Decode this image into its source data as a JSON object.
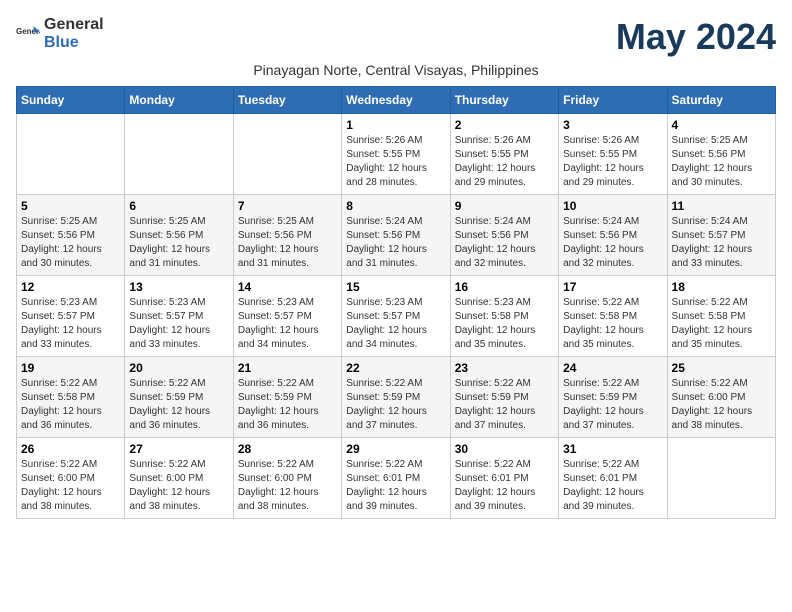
{
  "logo": {
    "general": "General",
    "blue": "Blue"
  },
  "title": "May 2024",
  "subtitle": "Pinayagan Norte, Central Visayas, Philippines",
  "days_header": [
    "Sunday",
    "Monday",
    "Tuesday",
    "Wednesday",
    "Thursday",
    "Friday",
    "Saturday"
  ],
  "weeks": [
    [
      {
        "day": "",
        "info": ""
      },
      {
        "day": "",
        "info": ""
      },
      {
        "day": "",
        "info": ""
      },
      {
        "day": "1",
        "info": "Sunrise: 5:26 AM\nSunset: 5:55 PM\nDaylight: 12 hours and 28 minutes."
      },
      {
        "day": "2",
        "info": "Sunrise: 5:26 AM\nSunset: 5:55 PM\nDaylight: 12 hours and 29 minutes."
      },
      {
        "day": "3",
        "info": "Sunrise: 5:26 AM\nSunset: 5:55 PM\nDaylight: 12 hours and 29 minutes."
      },
      {
        "day": "4",
        "info": "Sunrise: 5:25 AM\nSunset: 5:56 PM\nDaylight: 12 hours and 30 minutes."
      }
    ],
    [
      {
        "day": "5",
        "info": "Sunrise: 5:25 AM\nSunset: 5:56 PM\nDaylight: 12 hours and 30 minutes."
      },
      {
        "day": "6",
        "info": "Sunrise: 5:25 AM\nSunset: 5:56 PM\nDaylight: 12 hours and 31 minutes."
      },
      {
        "day": "7",
        "info": "Sunrise: 5:25 AM\nSunset: 5:56 PM\nDaylight: 12 hours and 31 minutes."
      },
      {
        "day": "8",
        "info": "Sunrise: 5:24 AM\nSunset: 5:56 PM\nDaylight: 12 hours and 31 minutes."
      },
      {
        "day": "9",
        "info": "Sunrise: 5:24 AM\nSunset: 5:56 PM\nDaylight: 12 hours and 32 minutes."
      },
      {
        "day": "10",
        "info": "Sunrise: 5:24 AM\nSunset: 5:56 PM\nDaylight: 12 hours and 32 minutes."
      },
      {
        "day": "11",
        "info": "Sunrise: 5:24 AM\nSunset: 5:57 PM\nDaylight: 12 hours and 33 minutes."
      }
    ],
    [
      {
        "day": "12",
        "info": "Sunrise: 5:23 AM\nSunset: 5:57 PM\nDaylight: 12 hours and 33 minutes."
      },
      {
        "day": "13",
        "info": "Sunrise: 5:23 AM\nSunset: 5:57 PM\nDaylight: 12 hours and 33 minutes."
      },
      {
        "day": "14",
        "info": "Sunrise: 5:23 AM\nSunset: 5:57 PM\nDaylight: 12 hours and 34 minutes."
      },
      {
        "day": "15",
        "info": "Sunrise: 5:23 AM\nSunset: 5:57 PM\nDaylight: 12 hours and 34 minutes."
      },
      {
        "day": "16",
        "info": "Sunrise: 5:23 AM\nSunset: 5:58 PM\nDaylight: 12 hours and 35 minutes."
      },
      {
        "day": "17",
        "info": "Sunrise: 5:22 AM\nSunset: 5:58 PM\nDaylight: 12 hours and 35 minutes."
      },
      {
        "day": "18",
        "info": "Sunrise: 5:22 AM\nSunset: 5:58 PM\nDaylight: 12 hours and 35 minutes."
      }
    ],
    [
      {
        "day": "19",
        "info": "Sunrise: 5:22 AM\nSunset: 5:58 PM\nDaylight: 12 hours and 36 minutes."
      },
      {
        "day": "20",
        "info": "Sunrise: 5:22 AM\nSunset: 5:59 PM\nDaylight: 12 hours and 36 minutes."
      },
      {
        "day": "21",
        "info": "Sunrise: 5:22 AM\nSunset: 5:59 PM\nDaylight: 12 hours and 36 minutes."
      },
      {
        "day": "22",
        "info": "Sunrise: 5:22 AM\nSunset: 5:59 PM\nDaylight: 12 hours and 37 minutes."
      },
      {
        "day": "23",
        "info": "Sunrise: 5:22 AM\nSunset: 5:59 PM\nDaylight: 12 hours and 37 minutes."
      },
      {
        "day": "24",
        "info": "Sunrise: 5:22 AM\nSunset: 5:59 PM\nDaylight: 12 hours and 37 minutes."
      },
      {
        "day": "25",
        "info": "Sunrise: 5:22 AM\nSunset: 6:00 PM\nDaylight: 12 hours and 38 minutes."
      }
    ],
    [
      {
        "day": "26",
        "info": "Sunrise: 5:22 AM\nSunset: 6:00 PM\nDaylight: 12 hours and 38 minutes."
      },
      {
        "day": "27",
        "info": "Sunrise: 5:22 AM\nSunset: 6:00 PM\nDaylight: 12 hours and 38 minutes."
      },
      {
        "day": "28",
        "info": "Sunrise: 5:22 AM\nSunset: 6:00 PM\nDaylight: 12 hours and 38 minutes."
      },
      {
        "day": "29",
        "info": "Sunrise: 5:22 AM\nSunset: 6:01 PM\nDaylight: 12 hours and 39 minutes."
      },
      {
        "day": "30",
        "info": "Sunrise: 5:22 AM\nSunset: 6:01 PM\nDaylight: 12 hours and 39 minutes."
      },
      {
        "day": "31",
        "info": "Sunrise: 5:22 AM\nSunset: 6:01 PM\nDaylight: 12 hours and 39 minutes."
      },
      {
        "day": "",
        "info": ""
      }
    ]
  ]
}
